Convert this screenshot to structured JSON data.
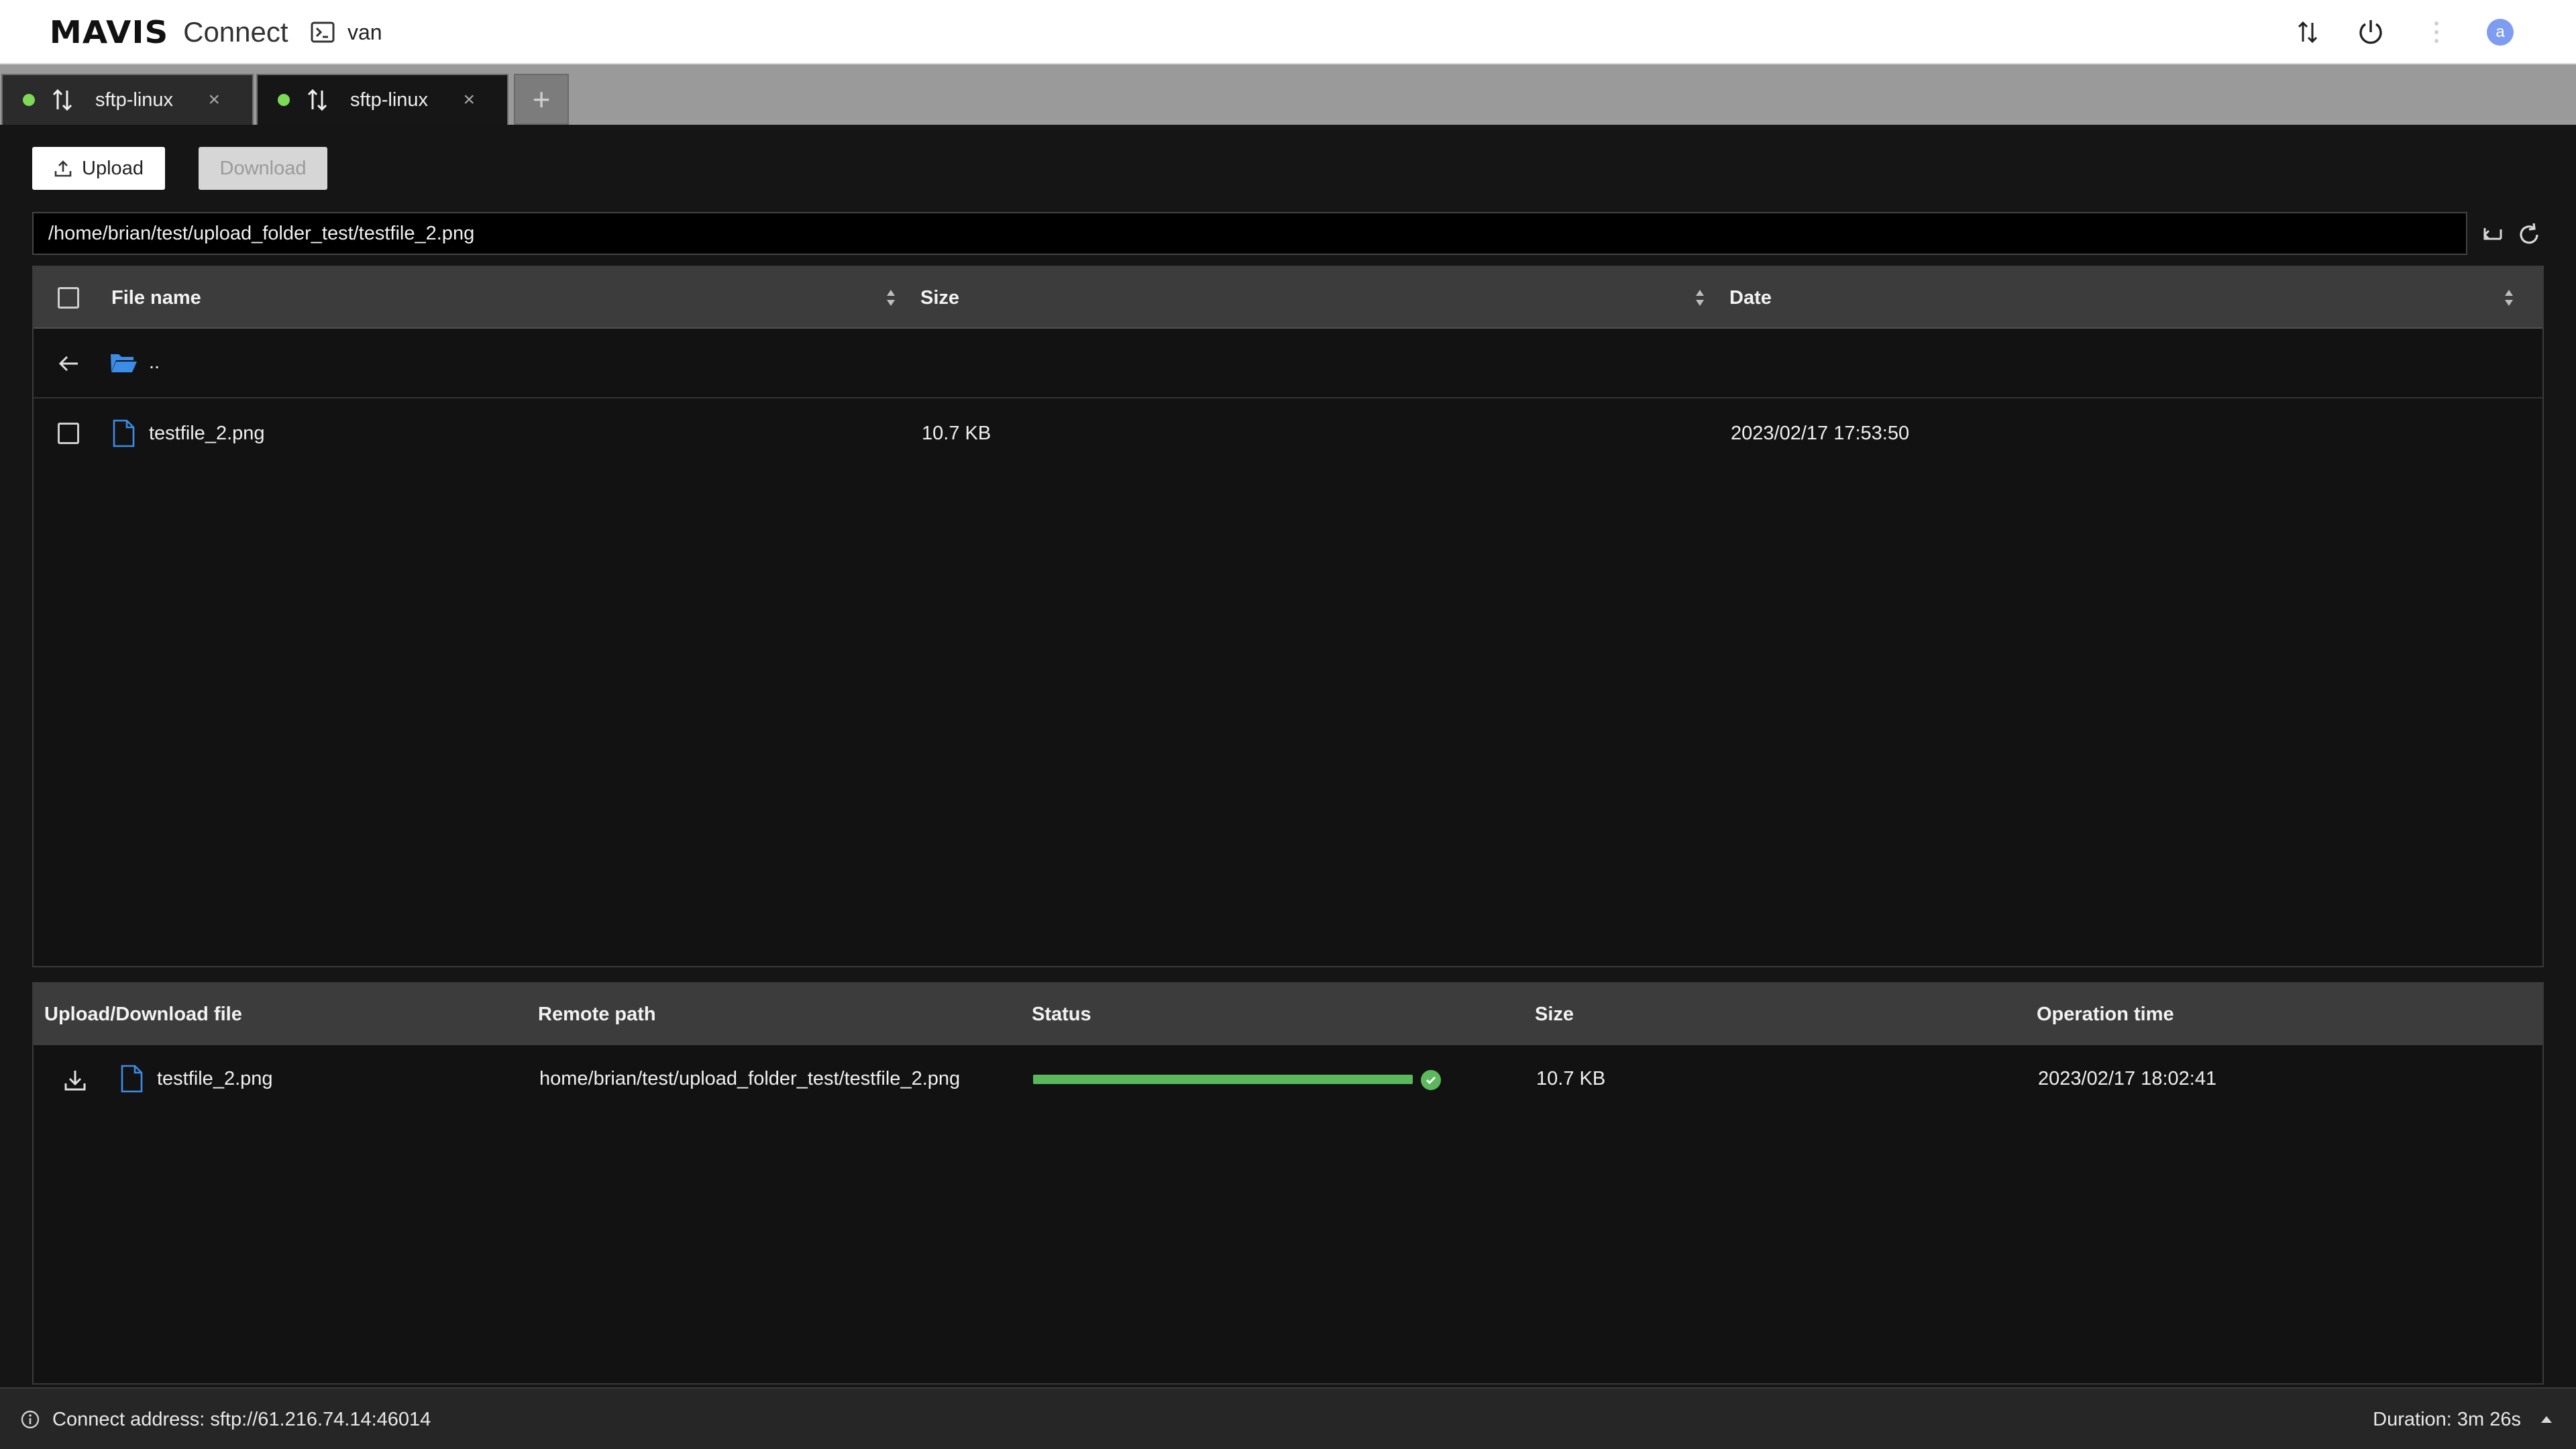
{
  "app": {
    "brand": "MAVIS",
    "product": "Connect",
    "session_label": "van",
    "avatar_letter": "a"
  },
  "tabs": [
    {
      "label": "sftp-linux",
      "active": false,
      "close": "×"
    },
    {
      "label": "sftp-linux",
      "active": true,
      "close": "×"
    }
  ],
  "tab_add_label": "+",
  "toolbar": {
    "upload_label": "Upload",
    "download_label": "Download"
  },
  "path": {
    "value": "/home/brian/test/upload_folder_test/testfile_2.png"
  },
  "file_table": {
    "headers": {
      "name": "File name",
      "size": "Size",
      "date": "Date"
    },
    "parent_label": "..",
    "rows": [
      {
        "name": "testfile_2.png",
        "size": "10.7 KB",
        "date": "2023/02/17 17:53:50"
      }
    ]
  },
  "splitter_label": ".....",
  "transfer_table": {
    "headers": {
      "file": "Upload/Download file",
      "remote_path": "Remote path",
      "status": "Status",
      "size": "Size",
      "time": "Operation time"
    },
    "rows": [
      {
        "direction": "download",
        "file": "testfile_2.png",
        "remote_path": "home/brian/test/upload_folder_test/testfile_2.png",
        "progress": 1.0,
        "size": "10.7 KB",
        "time": "2023/02/17 18:02:41"
      }
    ]
  },
  "status_bar": {
    "connect_address": "Connect address: sftp://61.216.74.14:46014",
    "duration": "Duration: 3m 26s"
  },
  "colors": {
    "accent_green": "#5cb85c",
    "status_dot": "#7ed957",
    "folder_blue": "#3b8de8",
    "avatar": "#7f9df0"
  }
}
